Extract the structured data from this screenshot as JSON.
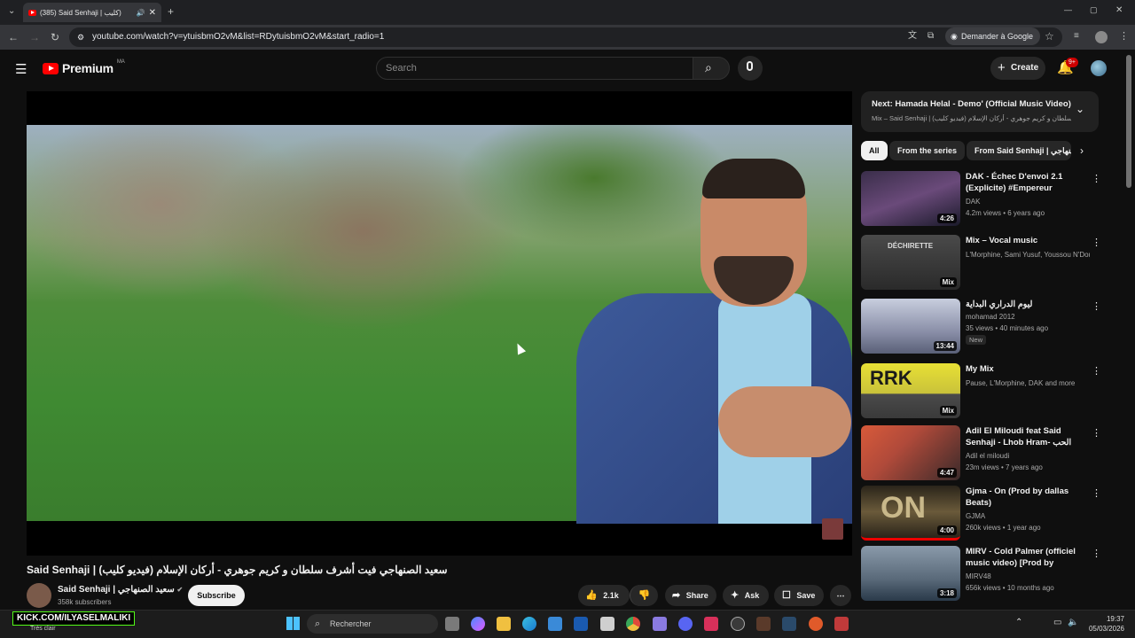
{
  "browser": {
    "tab_title": "(385) Said Senhaji | كليب)",
    "url": "youtube.com/watch?v=ytuisbmO2vM&list=RDytuisbmO2vM&start_radio=1",
    "google_button": "Demander à Google"
  },
  "header": {
    "logo": "Premium",
    "region": "MA",
    "search_placeholder": "Search",
    "create_label": "Create",
    "notification_badge": "9+"
  },
  "video": {
    "title": "Said Senhaji | سعيد الصنهاجي فيت أشرف سلطان و كريم جوهري - أركان الإسلام (فيديو كليب)",
    "channel": "Said Senhaji | سعيد الصنهاجي",
    "subscribers": "358k subscribers",
    "subscribe_label": "Subscribe",
    "likes": "2.1k",
    "share_label": "Share",
    "ask_label": "Ask",
    "save_label": "Save"
  },
  "up_next": {
    "title": "Next: Hamada Helal - Demo' (Official Music Video) /...",
    "subtitle": "Mix – Said Senhaji | سعيد الصنهاجي فيت أشرف سلطان و كريم جوهري - أركان الإسلام (فيديو كليب)"
  },
  "chips": [
    "All",
    "From the series",
    "From Said Senhaji | الصنهاجي"
  ],
  "recommendations": [
    {
      "title": "DAK - Échec D'envoi 2.1 (Explicite) #Empereur",
      "channel": "DAK",
      "meta": "4.2m views • 6 years ago",
      "badge": "4:26",
      "color": "#6a4a7a"
    },
    {
      "title": "Mix – Vocal music",
      "channel": "L'Morphine, Sami Yusuf, Youssou N'Dour...",
      "meta": "",
      "badge": "Mix",
      "color": "#5a5a5a"
    },
    {
      "title": "ليوم الدراري البداية",
      "channel": "mohamad 2012",
      "meta": "35 views • 40 minutes ago",
      "badge": "13:44",
      "new": "New",
      "color": "#8a8fa8"
    },
    {
      "title": "My Mix",
      "channel": "Pause, L'Morphine, DAK and more",
      "meta": "",
      "badge": "Mix",
      "color": "#c9c23a"
    },
    {
      "title": "Adil El Miloudi feat Said Senhaji - Lhob Hram- الحب حرام ...",
      "channel": "Adil el miloudi",
      "meta": "23m views • 7 years ago",
      "badge": "4:47",
      "color": "#b04a3a"
    },
    {
      "title": "Gjma - On (Prod by dallas Beats)",
      "channel": "GJMA",
      "meta": "260k views • 1 year ago",
      "badge": "4:00",
      "color": "#6a5a3a"
    },
    {
      "title": "MIRV - Cold Palmer (officiel music video) [Prod by INSANNE]",
      "channel": "MIRV48",
      "meta": "656k views • 10 months ago",
      "badge": "3:18",
      "color": "#5a6a7a"
    }
  ],
  "taskbar": {
    "search_label": "Rechercher",
    "kick_text": "KICK.COM/ILYASELMALIKI",
    "weather": "Très clair",
    "time": "19:37",
    "date": "05/03/2026"
  }
}
